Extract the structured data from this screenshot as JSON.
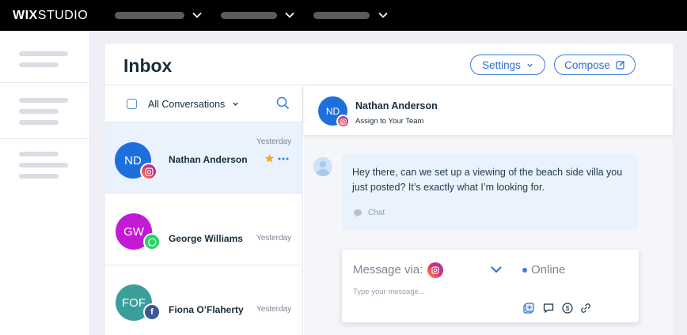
{
  "app": {
    "logo_bold": "WIX",
    "logo_light": "STUDIO"
  },
  "topnav": {
    "items": [
      {
        "icon": "chevron-down-icon"
      },
      {
        "icon": "chevron-down-icon"
      },
      {
        "icon": "chevron-down-icon"
      }
    ]
  },
  "header": {
    "title": "Inbox",
    "settings_label": "Settings",
    "compose_label": "Compose"
  },
  "list": {
    "filter_label": "All Conversations",
    "conversations": [
      {
        "initials": "ND",
        "name": "Nathan Anderson",
        "time": "Yesterday",
        "avatar_color": "#1d6fde",
        "channel": "instagram",
        "starred": true
      },
      {
        "initials": "GW",
        "name": "George Williams",
        "time": "Yesterday",
        "avatar_color": "#c31ad6",
        "channel": "whatsapp",
        "starred": false
      },
      {
        "initials": "FOF",
        "name": "Fiona O’Flaherty",
        "time": "Yesterday",
        "avatar_color": "#3a9e9b",
        "channel": "facebook",
        "starred": false
      }
    ]
  },
  "chat": {
    "contact_initials": "ND",
    "contact_name": "Nathan Anderson",
    "contact_sub": "Assign to Your Team",
    "message": "Hey there, can we set up a viewing of the beach side villa you just posted? It’s exactly what I’m looking for.",
    "channel_label": "Chat",
    "composer": {
      "via_label": "Message via:",
      "status": "Online",
      "placeholder": "Type your message..."
    }
  },
  "colors": {
    "accent": "#2e6bd1",
    "active_row": "#e9f2fd",
    "star": "#f5a623"
  }
}
